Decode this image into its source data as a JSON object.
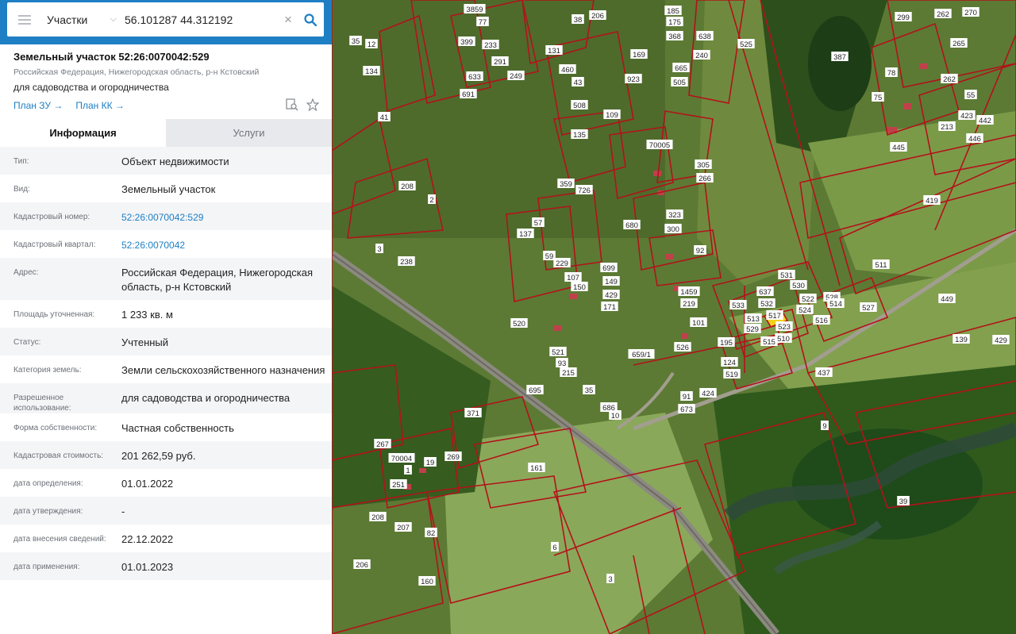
{
  "search": {
    "layer": "Участки",
    "query": "56.101287 44.312192"
  },
  "object": {
    "title": "Земельный участок 52:26:0070042:529",
    "region": "Российская Федерация, Нижегородская область, р-н Кстовский",
    "usage": "для садоводства и огородничества",
    "plan_zu": "План ЗУ →",
    "plan_kk": "План КК →"
  },
  "tabs": [
    "Информация",
    "Услуги"
  ],
  "rows": [
    {
      "label": "Тип:",
      "value": "Объект недвижимости"
    },
    {
      "label": "Вид:",
      "value": "Земельный участок"
    },
    {
      "label": "Кадастровый номер:",
      "value": "52:26:0070042:529",
      "link": true
    },
    {
      "label": "Кадастровый квартал:",
      "value": "52:26:0070042",
      "link": true
    },
    {
      "label": "Адрес:",
      "value": "Российская Федерация, Нижегородская область, р-н Кстовский"
    },
    {
      "label": "Площадь уточненная:",
      "value": "1 233 кв. м"
    },
    {
      "label": "Статус:",
      "value": "Учтенный"
    },
    {
      "label": "Категория земель:",
      "value": "Земли сельскохозяйственного назначения"
    },
    {
      "label": "Разрешенное использование:",
      "value": "для садоводства и огородничества"
    },
    {
      "label": "Форма собственности:",
      "value": "Частная собственность"
    },
    {
      "label": "Кадастровая стоимость:",
      "value": "201 262,59 руб."
    },
    {
      "label": "дата определения:",
      "value": "01.01.2022"
    },
    {
      "label": "дата утверждения:",
      "value": "-"
    },
    {
      "label": "дата внесения сведений:",
      "value": "22.12.2022"
    },
    {
      "label": "дата применения:",
      "value": "01.01.2023"
    }
  ],
  "map": {
    "parcel_labels": [
      "3859",
      "77",
      "38",
      "206",
      "185",
      "175",
      "368",
      "638",
      "525",
      "387",
      "299",
      "262",
      "270",
      "399",
      "233",
      "291",
      "249",
      "633",
      "691",
      "131",
      "460",
      "43",
      "169",
      "923",
      "240",
      "665",
      "505",
      "508",
      "109",
      "134",
      "41",
      "35",
      "12",
      "135",
      "70005",
      "305",
      "266",
      "359",
      "726",
      "208",
      "2",
      "3",
      "238",
      "57",
      "137",
      "59",
      "229",
      "107",
      "150",
      "680",
      "323",
      "300",
      "92",
      "699",
      "149",
      "429",
      "171",
      "1459",
      "219",
      "101",
      "637",
      "531",
      "532",
      "530",
      "533",
      "522",
      "517",
      "513",
      "529",
      "523",
      "524",
      "528",
      "516",
      "514",
      "515",
      "510",
      "527",
      "526",
      "195",
      "124",
      "519",
      "520",
      "521",
      "93",
      "215",
      "35",
      "659/1",
      "91",
      "424",
      "673",
      "695",
      "686",
      "10",
      "371",
      "267",
      "70004",
      "1",
      "19",
      "269",
      "251",
      "206",
      "207",
      "208",
      "82",
      "160",
      "161",
      "6",
      "3",
      "9",
      "437",
      "511",
      "419",
      "449",
      "139",
      "429",
      "39",
      "55",
      "75",
      "262",
      "265",
      "213",
      "423",
      "442",
      "446",
      "445",
      "78"
    ],
    "selected_parcel": "529",
    "colors": {
      "boundary": "#b3121a",
      "selected": "#f2d11a",
      "accent": "#1e7fc4"
    }
  }
}
